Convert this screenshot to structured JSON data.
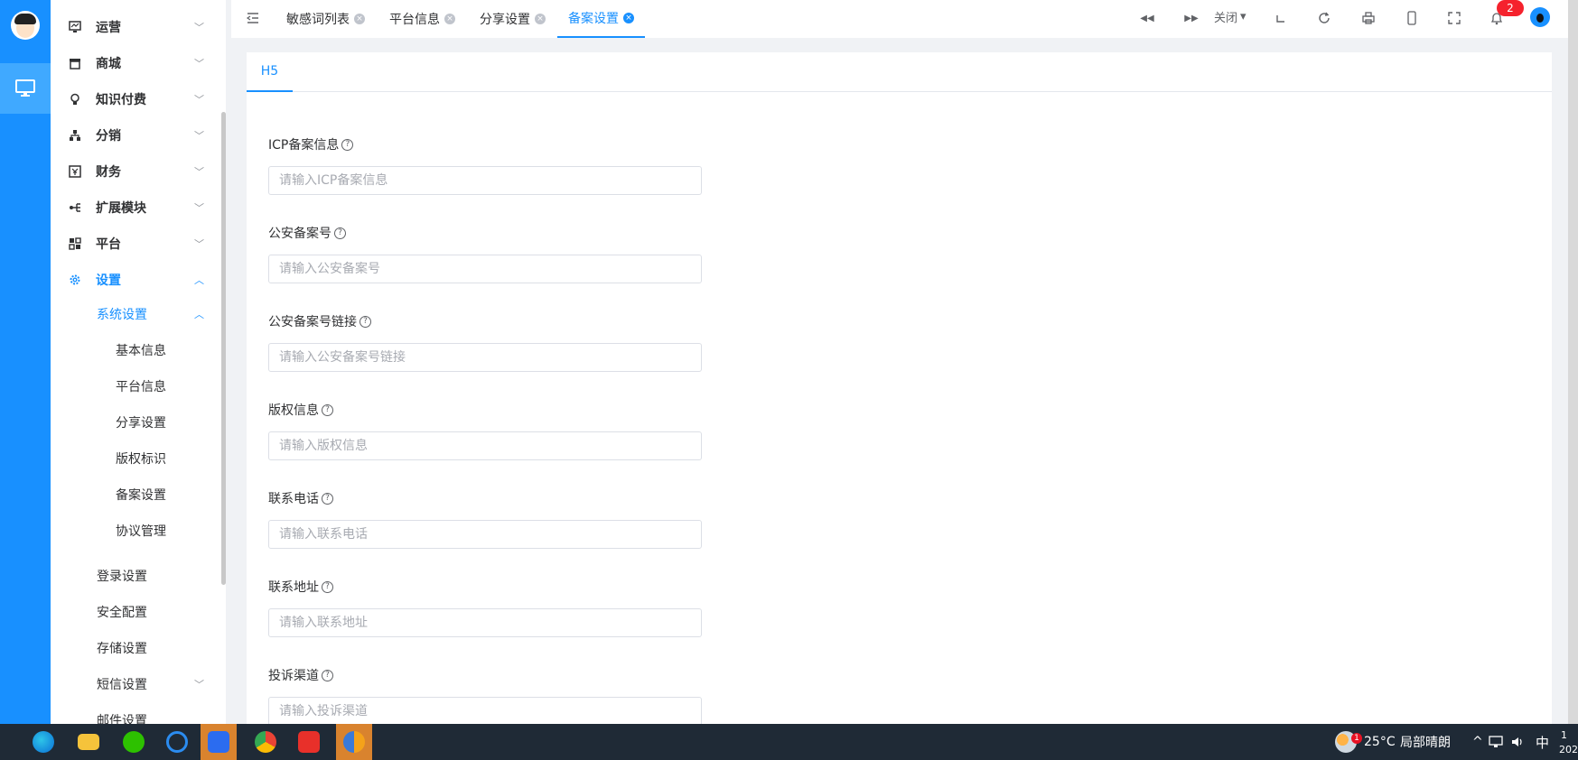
{
  "sidebar": {
    "menu": [
      {
        "label": "运营",
        "icon": "monitor-chart-icon",
        "chevron": "﹀"
      },
      {
        "label": "商城",
        "icon": "store-icon",
        "chevron": "﹀"
      },
      {
        "label": "知识付费",
        "icon": "lightbulb-icon",
        "chevron": "﹀"
      },
      {
        "label": "分销",
        "icon": "hierarchy-icon",
        "chevron": "﹀"
      },
      {
        "label": "财务",
        "icon": "finance-icon",
        "chevron": "﹀"
      },
      {
        "label": "扩展模块",
        "icon": "extension-icon",
        "chevron": "﹀"
      },
      {
        "label": "平台",
        "icon": "platform-icon",
        "chevron": "﹀"
      },
      {
        "label": "设置",
        "icon": "gear-icon",
        "chevron": "︿"
      }
    ],
    "system_settings": {
      "label": "系统设置",
      "chevron": "︿"
    },
    "system_children": [
      "基本信息",
      "平台信息",
      "分享设置",
      "版权标识",
      "备案设置",
      "协议管理"
    ],
    "settings_children": [
      {
        "label": "登录设置",
        "chevron": ""
      },
      {
        "label": "安全配置",
        "chevron": ""
      },
      {
        "label": "存储设置",
        "chevron": ""
      },
      {
        "label": "短信设置",
        "chevron": "﹀"
      },
      {
        "label": "邮件设置",
        "chevron": ""
      }
    ]
  },
  "tabs": [
    {
      "label": "敏感词列表",
      "close": "×"
    },
    {
      "label": "平台信息",
      "close": "×"
    },
    {
      "label": "分享设置",
      "close": "×"
    },
    {
      "label": "备案设置",
      "close": "×"
    }
  ],
  "toolbar": {
    "close_label": "关闭",
    "close_caret": "▾",
    "prev_glyph": "◀◀",
    "next_glyph": "▶▶",
    "notification_count": "2",
    "icons": [
      "back-double-icon",
      "forward-double-icon",
      "bracket-icon",
      "refresh-icon",
      "printer-icon",
      "mobile-icon",
      "fullscreen-icon",
      "bell-icon"
    ]
  },
  "content": {
    "tab_label": "H5",
    "help_glyph": "?",
    "fields": [
      {
        "label": "ICP备案信息",
        "placeholder": "请输入ICP备案信息"
      },
      {
        "label": "公安备案号",
        "placeholder": "请输入公安备案号"
      },
      {
        "label": "公安备案号链接",
        "placeholder": "请输入公安备案号链接"
      },
      {
        "label": "版权信息",
        "placeholder": "请输入版权信息"
      },
      {
        "label": "联系电话",
        "placeholder": "请输入联系电话"
      },
      {
        "label": "联系地址",
        "placeholder": "请输入联系地址"
      },
      {
        "label": "投诉渠道",
        "placeholder": "请输入投诉渠道"
      }
    ]
  },
  "taskbar": {
    "weather": "25°C",
    "weather_desc": "局部晴朗",
    "weather_badge": "1",
    "ime": "中",
    "tray_chevron": "^",
    "clock_line1": "1",
    "clock_line2": "202",
    "apps": [
      "edge-icon",
      "file-explorer-icon",
      "wechat-icon",
      "search-app-icon",
      "feishu-icon",
      "chrome-icon",
      "wps-icon",
      "chrome-canary-icon"
    ],
    "colors": {
      "bar": "#1f2a36",
      "highlight": "#d9832e"
    }
  },
  "colors": {
    "primary": "#1890ff",
    "badge": "#f5222d"
  }
}
